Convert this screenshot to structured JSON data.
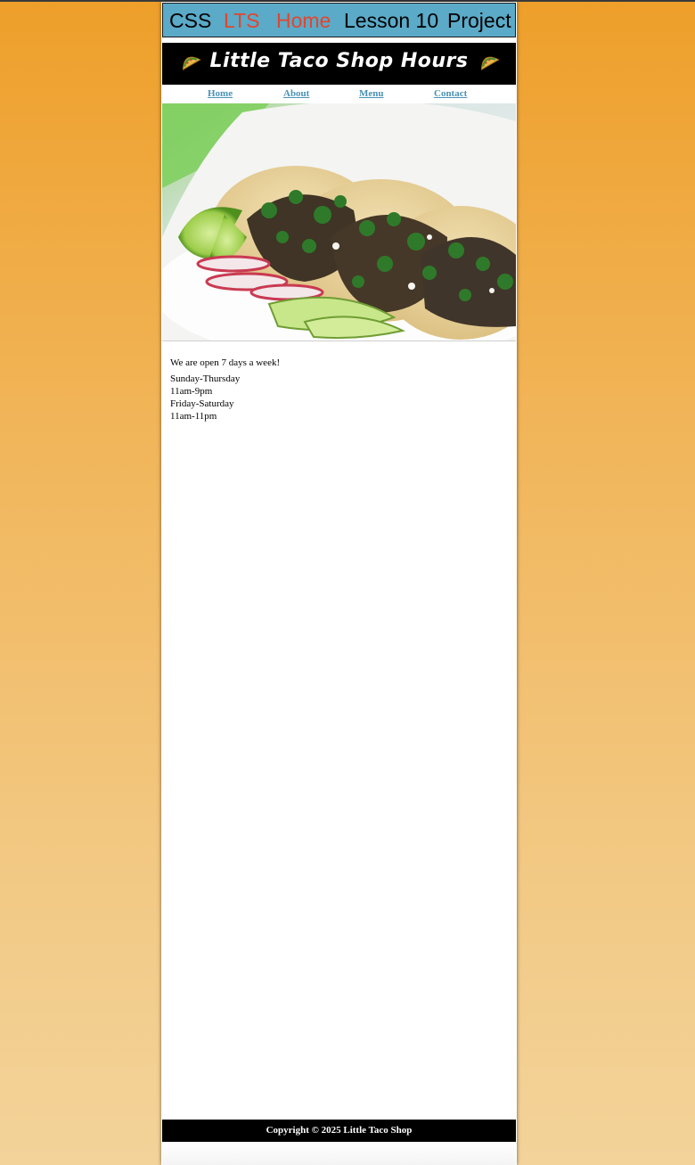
{
  "banner": {
    "css": "CSS",
    "lts": "LTS",
    "home": "Home",
    "lesson": "Lesson 10",
    "project": "Project"
  },
  "title": "Little Taco Shop Hours",
  "nav": {
    "home": "Home",
    "about": "About",
    "menu": "Menu",
    "contact": "Contact"
  },
  "hero": {
    "icon": "tacos-photo"
  },
  "content": {
    "intro": "We are open 7 days a week!",
    "hours": [
      "Sunday-Thursday",
      "11am-9pm",
      "Friday-Saturday",
      "11am-11pm"
    ]
  },
  "footer": {
    "copyright": "Copyright © 2025 Little Taco Shop"
  },
  "colors": {
    "banner_bg": "#5aaac8",
    "banner_accent": "#e4452c",
    "nav_link": "#4a93b6",
    "page_bg_top": "#ee9f2a",
    "page_bg_bottom": "#f3d39a"
  }
}
